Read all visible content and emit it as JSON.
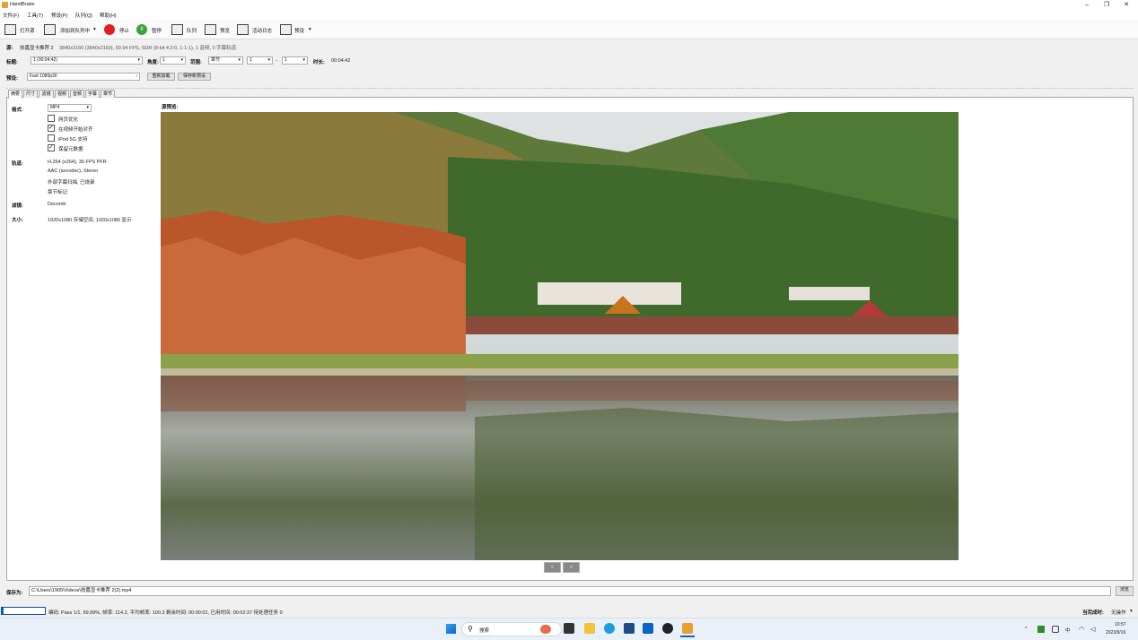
{
  "window": {
    "title": "HandBrake"
  },
  "menu": [
    "文件(F)",
    "工具(T)",
    "预设(P)",
    "队列(Q)",
    "帮助(H)"
  ],
  "toolbar": {
    "open": "打开源",
    "add_queue": "添加到队列中",
    "stop": "停止",
    "pause": "暂停",
    "queue": "队列",
    "preview": "预览",
    "activity": "活动日志",
    "presets": "预设"
  },
  "source": {
    "label": "源:",
    "name": "技嘉显卡推荐 2",
    "info": "3840x2160 (3840x2160), 59.94 FPS, SDR (8-bit 4:2:0, 1-1-1), 1 音频, 0 字幕轨道"
  },
  "title_row": {
    "title_label": "标题:",
    "title_value": "1  (00:04:42)",
    "angle_label": "角度:",
    "angle_value": "1",
    "range_label": "范围:",
    "range_value": "章节",
    "range_from": "1",
    "range_sep": "-",
    "range_to": "1",
    "duration_label": "时长:",
    "duration_value": "00:04:42"
  },
  "preset_row": {
    "label": "预设:",
    "value": "Fast 1080p30",
    "reload": "重新加载",
    "save_new": "保存新预设"
  },
  "tabs": [
    "摘要",
    "尺寸",
    "滤镜",
    "视频",
    "音频",
    "字幕",
    "章节"
  ],
  "summary": {
    "format_label": "格式:",
    "format_value": "MP4",
    "checks": [
      {
        "label": "网页优化",
        "checked": false
      },
      {
        "label": "在视频开始对齐",
        "checked": true
      },
      {
        "label": "iPod 5G 支持",
        "checked": false
      },
      {
        "label": "保留元数据",
        "checked": true
      }
    ],
    "tracks_label": "轨道:",
    "tracks": [
      "H.264 (x264), 30 FPS PFR",
      "AAC (avcodec), Stereo",
      "外部字幕扫描, 已烧录",
      "章节标记"
    ],
    "filters_label": "滤镜:",
    "filters_value": "Decomb",
    "size_label": "大小:",
    "size_value": "1920x1080 存储空间, 1920x1080 显示",
    "preview_label": "源预览:"
  },
  "nav": {
    "prev": "<",
    "next": ">"
  },
  "save_row": {
    "label": "保存为:",
    "path": "C:\\Users\\1905\\Videos\\技嘉显卡推荐 2(2).mp4",
    "browse": "浏览"
  },
  "status": {
    "progress": 0.04,
    "text": "编码: Pass 1/1,  99.99%,  帧率: 114.2,  平均帧率: 100.3  剩余时间: 00:00:01,  已用时间: 00:02:37  待处理任务 0",
    "when_done_label": "当完成时:",
    "when_done_value": "无操作"
  },
  "taskbar": {
    "search": "搜索",
    "tray": [
      "^",
      "中"
    ],
    "time": "10:57",
    "date": "2023/9/16"
  },
  "colors": {
    "accent": "#0a63c9",
    "stop": "#e02020",
    "pause": "#3aa53a"
  }
}
